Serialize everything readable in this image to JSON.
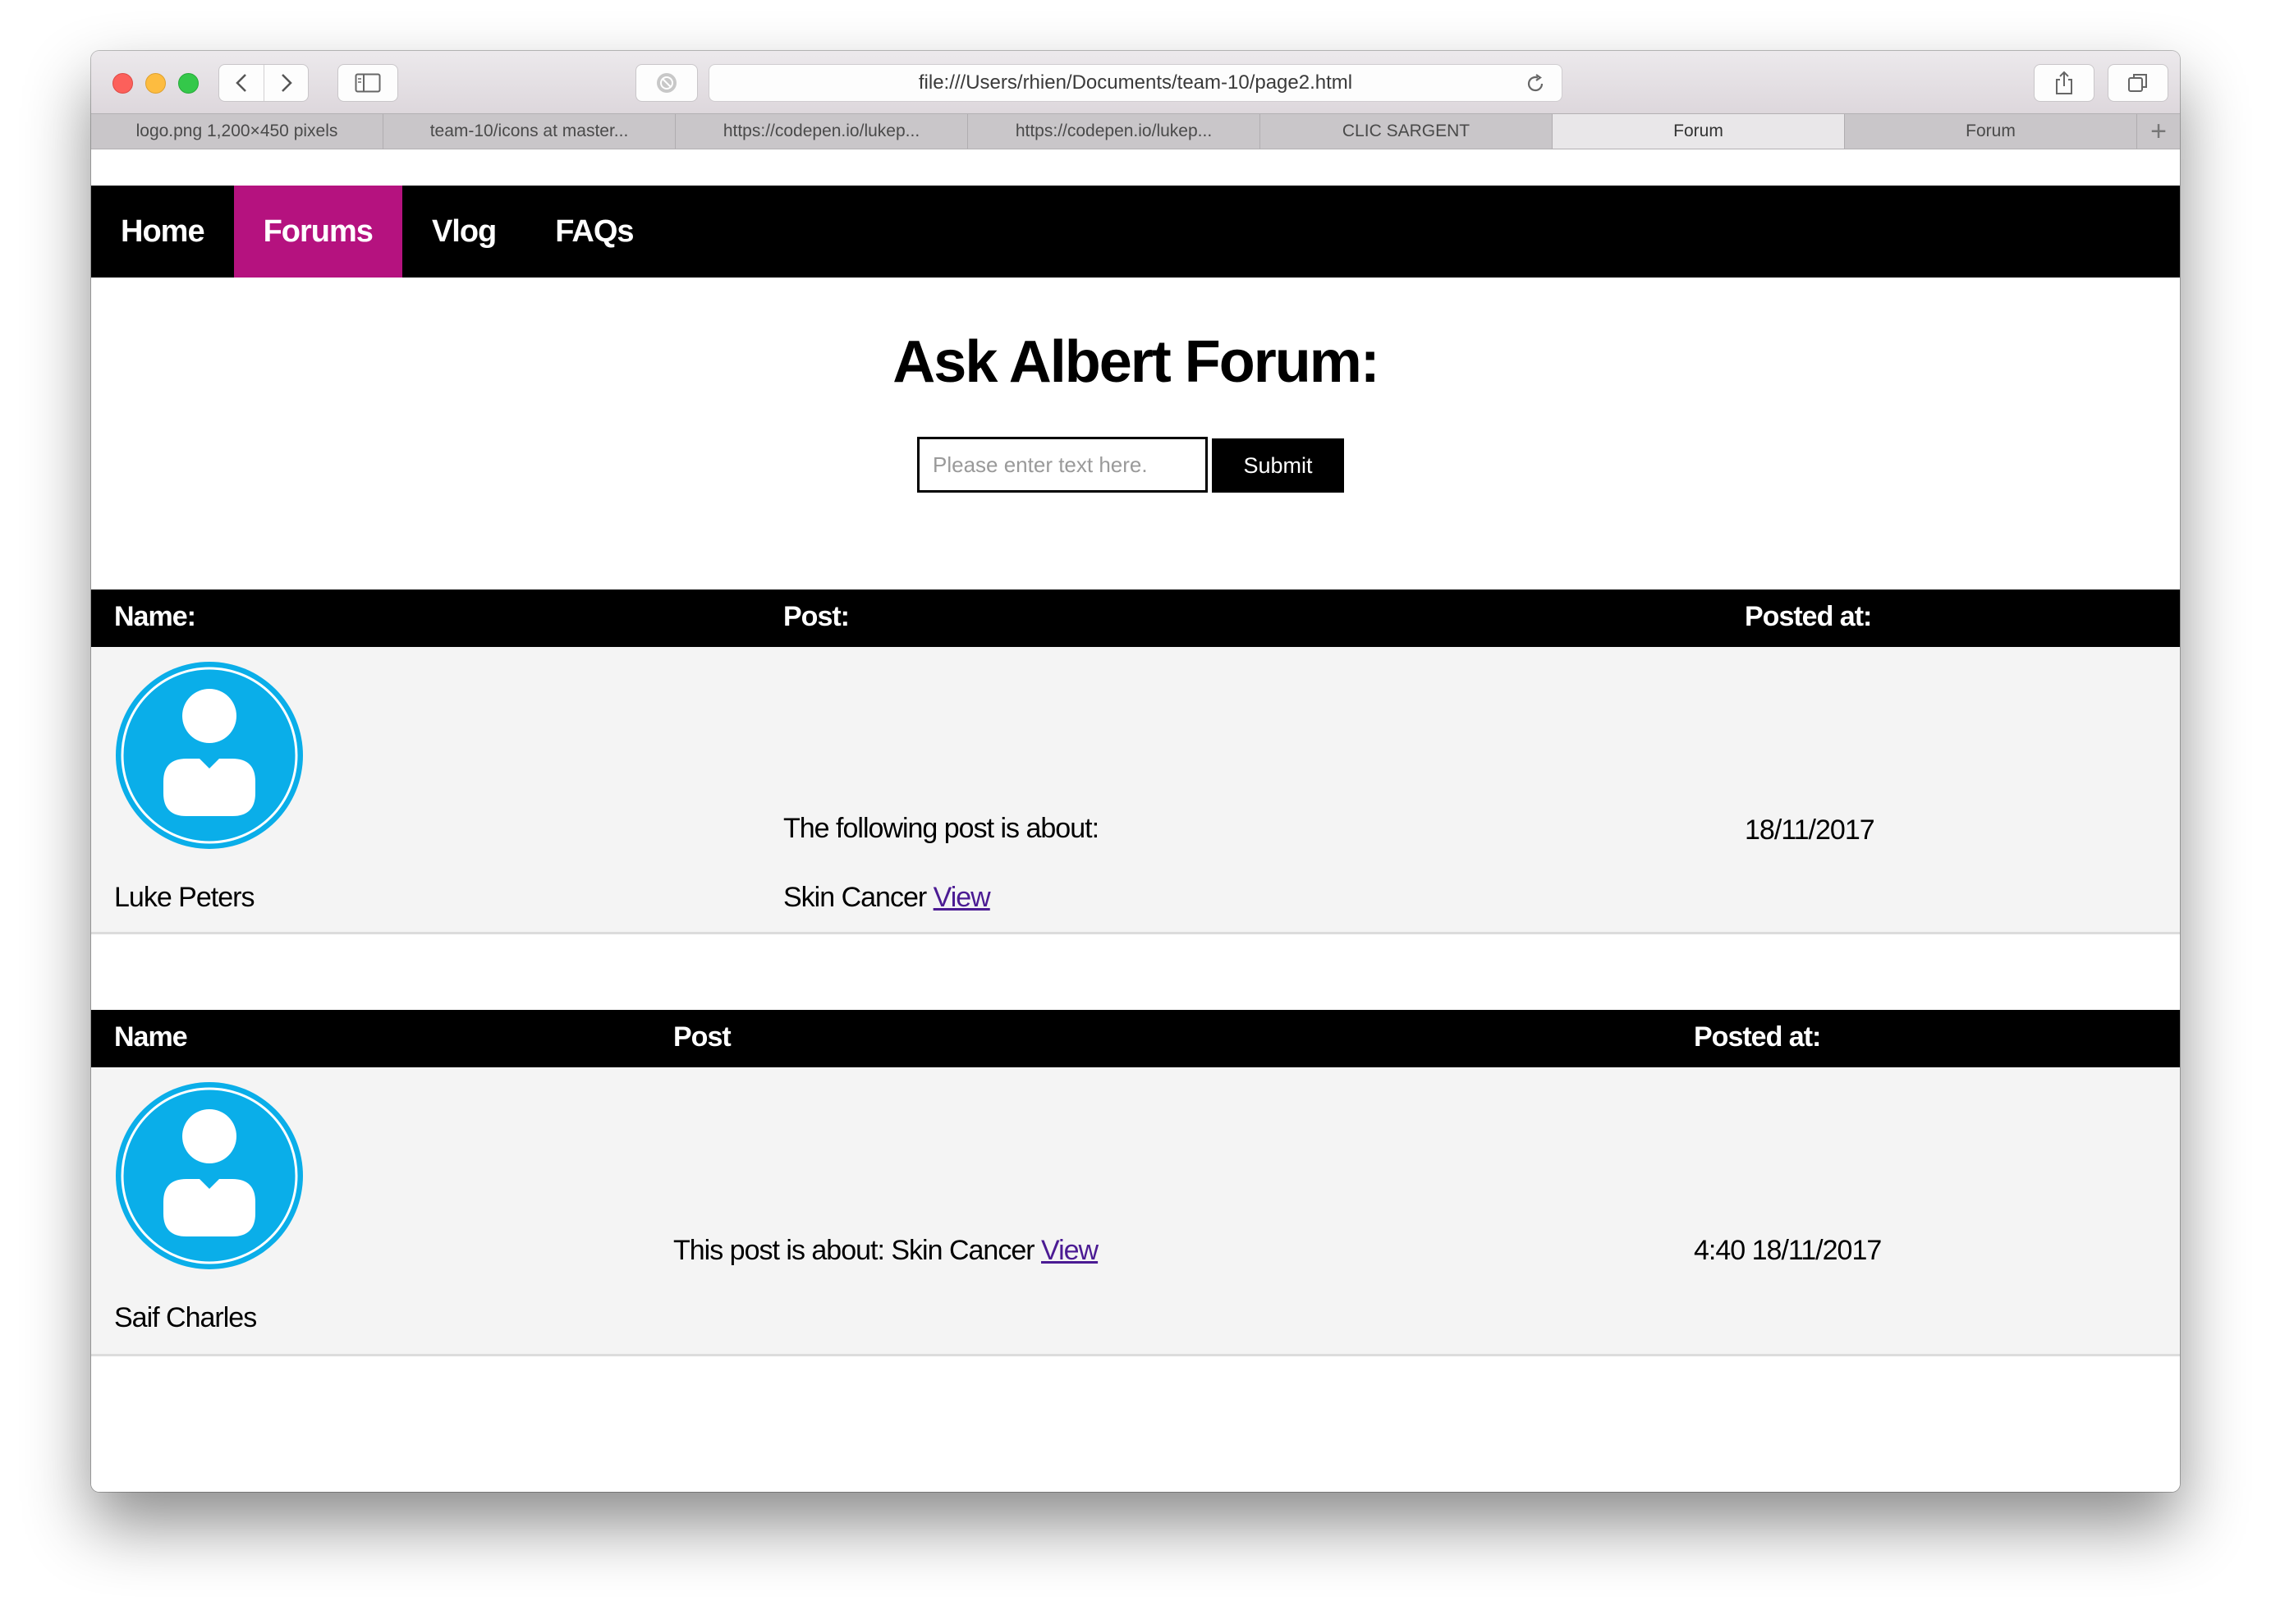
{
  "browser": {
    "url": "file:///Users/rhien/Documents/team-10/page2.html",
    "tabs": [
      {
        "label": "logo.png 1,200×450 pixels",
        "active": false
      },
      {
        "label": "team-10/icons at master...",
        "active": false
      },
      {
        "label": "https://codepen.io/lukep...",
        "active": false
      },
      {
        "label": "https://codepen.io/lukep...",
        "active": false
      },
      {
        "label": "CLIC SARGENT",
        "active": false
      },
      {
        "label": "Forum",
        "active": true
      },
      {
        "label": "Forum",
        "active": false
      }
    ],
    "new_tab_label": "+"
  },
  "nav": {
    "items": [
      {
        "label": "Home",
        "active": false
      },
      {
        "label": "Forums",
        "active": true
      },
      {
        "label": "Vlog",
        "active": false
      },
      {
        "label": "FAQs",
        "active": false
      }
    ]
  },
  "forum": {
    "title": "Ask Albert Forum:",
    "input_placeholder": "Please enter text here.",
    "submit_label": "Submit"
  },
  "posts": [
    {
      "header": {
        "name": "Name:",
        "post": "Post:",
        "posted_at": "Posted at:"
      },
      "name": "Luke Peters",
      "post_line1": "The following post is about:",
      "post_line2": "Skin Cancer",
      "link": "View",
      "posted_at": "18/11/2017"
    },
    {
      "header": {
        "name": "Name",
        "post": "Post",
        "posted_at": "Posted at:"
      },
      "name": "Saif Charles",
      "post_text": "This post is about: Skin Cancer",
      "link": "View",
      "posted_at": "4:40 18/11/2017"
    }
  ],
  "colors": {
    "nav_active": "#b5127f",
    "avatar": "#0aaee9",
    "link": "#4b1b93"
  }
}
